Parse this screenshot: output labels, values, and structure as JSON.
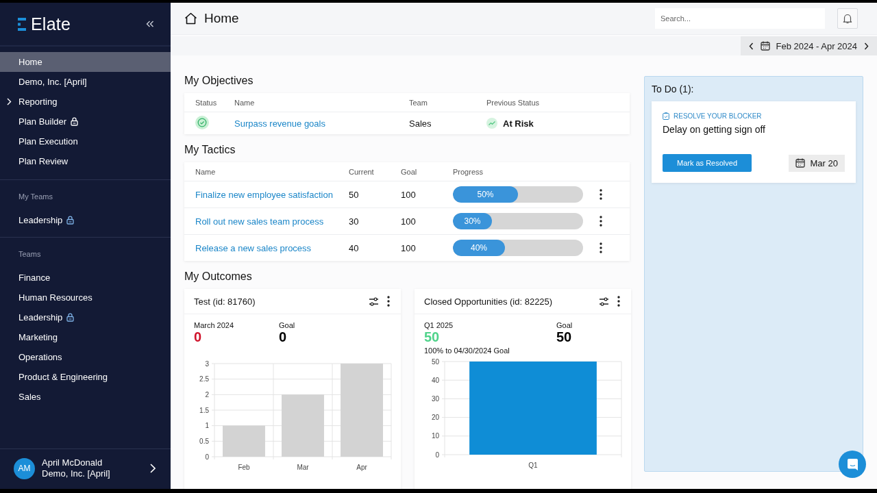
{
  "sidebar": {
    "brand": "Elate",
    "nav": [
      {
        "label": "Home",
        "selected": true,
        "locked": false,
        "kind": "link"
      },
      {
        "label": "Demo, Inc. [April]",
        "selected": false,
        "locked": false,
        "kind": "link"
      },
      {
        "label": "Reporting",
        "selected": false,
        "locked": false,
        "kind": "group"
      },
      {
        "label": "Plan Builder",
        "selected": false,
        "locked": true,
        "kind": "link"
      },
      {
        "label": "Plan Execution",
        "selected": false,
        "locked": false,
        "kind": "link"
      },
      {
        "label": "Plan Review",
        "selected": false,
        "locked": false,
        "kind": "link"
      }
    ],
    "my_teams": {
      "heading": "My Teams",
      "items": [
        {
          "label": "Leadership",
          "selected": false,
          "locked": true
        }
      ]
    },
    "teams": {
      "heading": "Teams",
      "items": [
        {
          "label": "Finance",
          "selected": false,
          "locked": false
        },
        {
          "label": "Human Resources",
          "selected": false,
          "locked": false
        },
        {
          "label": "Leadership",
          "selected": false,
          "locked": true
        },
        {
          "label": "Marketing",
          "selected": false,
          "locked": false
        },
        {
          "label": "Operations",
          "selected": false,
          "locked": false
        },
        {
          "label": "Product & Engineering",
          "selected": false,
          "locked": false
        },
        {
          "label": "Sales",
          "selected": false,
          "locked": false
        }
      ]
    },
    "user": {
      "initials": "AM",
      "name": "April McDonald",
      "org": "Demo, Inc. [April]"
    }
  },
  "header": {
    "title": "Home",
    "search": {
      "placeholder": "Search..."
    }
  },
  "date_range": {
    "label": "Feb 2024 - Apr 2024"
  },
  "objectives": {
    "title": "My Objectives",
    "columns": [
      "Status",
      "Name",
      "Team",
      "Previous Status"
    ],
    "rows": [
      {
        "kind": "on_track",
        "name": "Surpass revenue goals",
        "team": "Sales",
        "previous_status": "At Risk"
      }
    ]
  },
  "tactics": {
    "title": "My Tactics",
    "columns": [
      "Name",
      "Current",
      "Goal",
      "Progress"
    ],
    "rows": [
      {
        "name": "Finalize new employee satisfaction",
        "current": "50",
        "goal": "100",
        "level": 0.5,
        "progress_label": "50%"
      },
      {
        "name": "Roll out new sales team process",
        "current": "30",
        "goal": "100",
        "level": 0.3,
        "progress_label": "30%"
      },
      {
        "name": "Release a new sales process",
        "current": "40",
        "goal": "100",
        "level": 0.4,
        "progress_label": "40%"
      }
    ]
  },
  "outcomes": {
    "title": "My Outcomes",
    "cards": [
      {
        "title": "Test (id: 81760)",
        "period": "March 2024",
        "value": "0",
        "kind": "behind",
        "goal_label": "Goal",
        "goal": "0",
        "chart_data": {
          "type": "bar",
          "grid": true,
          "categories": [
            "Feb",
            "Mar",
            "Apr"
          ],
          "series": [
            {
              "color": "#d3d3d3",
              "values": [
                1,
                2,
                3
              ]
            }
          ],
          "ylim": [
            0,
            3
          ],
          "yticks": [
            0,
            0.5,
            1,
            1.5,
            2,
            2.5,
            3
          ]
        }
      },
      {
        "title": "Closed Opportunities (id: 82225)",
        "period": "Q1 2025",
        "value": "50",
        "kind": "met",
        "goal_label": "Goal",
        "goal": "50",
        "note": "100% to 04/30/2024 Goal",
        "chart_data": {
          "type": "bar",
          "grid": true,
          "categories": [
            "Q1"
          ],
          "series": [
            {
              "color": "#0f8dd6",
              "values": [
                50
              ]
            }
          ],
          "ylim": [
            0,
            50
          ],
          "yticks": [
            0,
            10,
            20,
            30,
            40,
            50
          ]
        }
      }
    ]
  },
  "todo": {
    "title": "To Do (1):",
    "items": [
      {
        "category": "RESOLVE YOUR BLOCKER",
        "text": "Delay on getting sign off",
        "action": "Mark as Resolved",
        "due": "Mar 20"
      }
    ]
  }
}
